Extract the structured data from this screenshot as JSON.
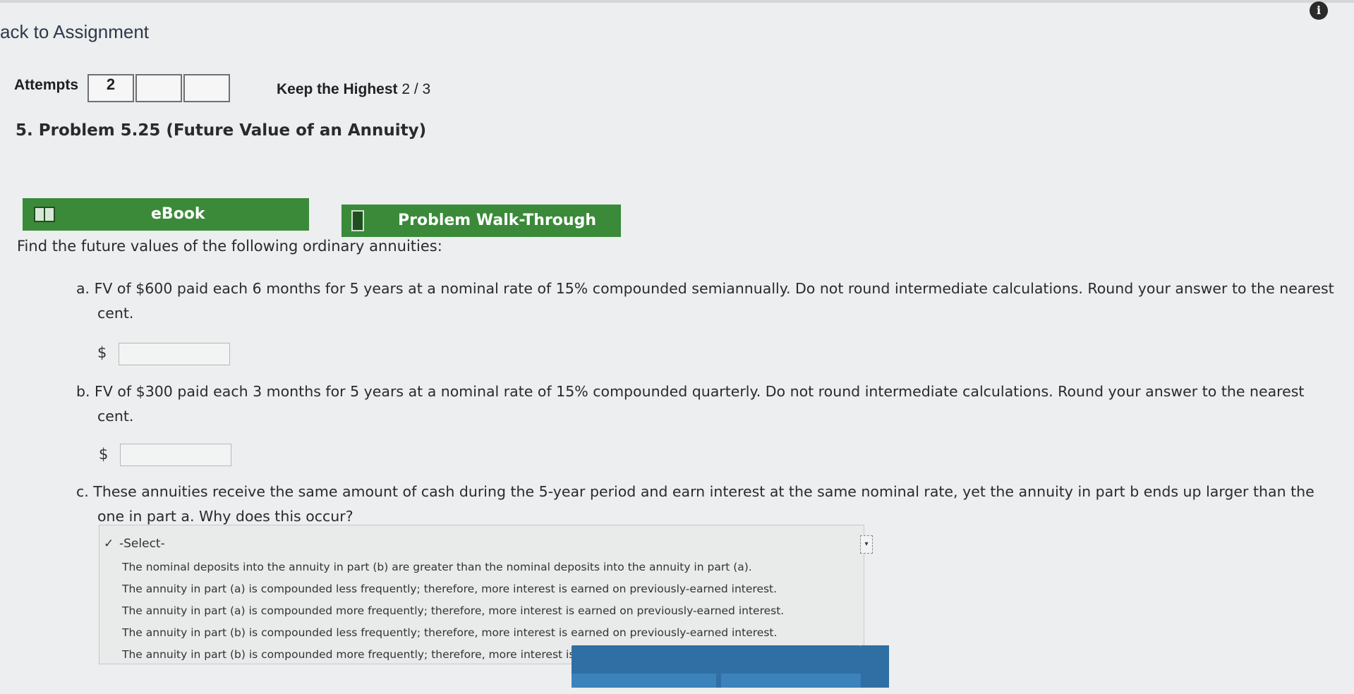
{
  "header": {
    "back_label": "ack to Assignment"
  },
  "attempts": {
    "label": "Attempts",
    "boxes": [
      "2",
      "",
      ""
    ],
    "keep_label": "Keep the Highest",
    "keep_score": "2 / 3"
  },
  "problem": {
    "title": "5. Problem 5.25 (Future Value of an Annuity)"
  },
  "tools": {
    "ebook_label": "eBook",
    "walkthrough_label": "Problem Walk-Through"
  },
  "instructions": "Find the future values of the following ordinary annuities:",
  "parts": {
    "a": {
      "line1": "a. FV of $600 paid each 6 months for 5 years at a nominal rate of 15% compounded semiannually. Do not round intermediate calculations. Round your answer to the nearest",
      "line2": "cent.",
      "currency": "$",
      "value": ""
    },
    "b": {
      "line1": "b. FV of $300 paid each 3 months for 5 years at a nominal rate of 15% compounded quarterly. Do not round intermediate calculations. Round your answer to the nearest",
      "line2": "cent.",
      "currency": "$",
      "value": ""
    },
    "c": {
      "line1": "c. These annuities receive the same amount of cash during the 5-year period and earn interest at the same nominal rate, yet the annuity in part b ends up larger than the",
      "line2": "one in part a. Why does this occur?"
    }
  },
  "dropdown": {
    "check": "✓",
    "selected": "-Select-",
    "options": [
      "The nominal deposits into the annuity in part (b) are greater than the nominal deposits into the annuity in part (a).",
      "The annuity in part (a) is compounded less frequently; therefore, more interest is earned on previously-earned interest.",
      "The annuity in part (a) is compounded more frequently; therefore, more interest is earned on previously-earned interest.",
      "The annuity in part (b) is compounded less frequently; therefore, more interest is earned on previously-earned interest.",
      "The annuity in part (b) is compounded more frequently; therefore, more interest is earned on previously-earned interest."
    ]
  },
  "icons": {
    "info": "info-icon",
    "ebook": "book-icon",
    "walkthrough": "document-icon",
    "dropdown_arrow": "chevron-down-icon"
  },
  "colors": {
    "green_button": "#3a8a3a",
    "blue_button": "#2f6fa3"
  }
}
